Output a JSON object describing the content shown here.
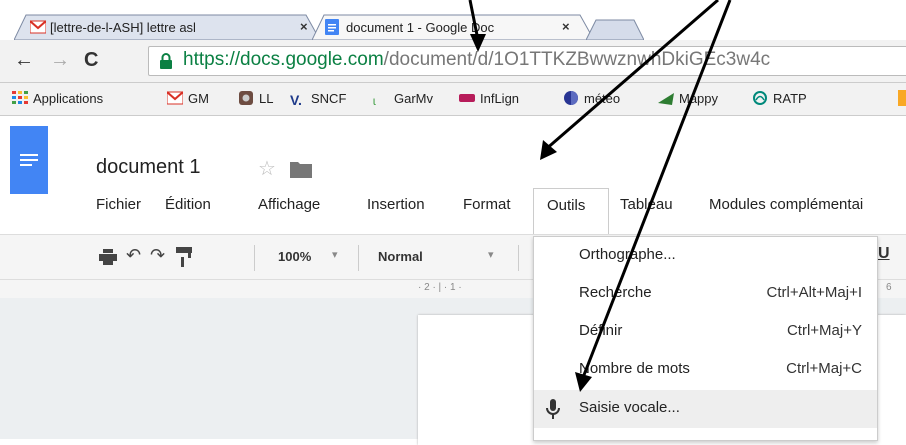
{
  "tabs": [
    {
      "title": "[lettre-de-l-ASH] lettre asl",
      "close": "×"
    },
    {
      "title": "document 1 - Google Doc",
      "close": "×"
    }
  ],
  "address": {
    "url_host": "https://docs.google.com",
    "url_path": "/document/d/1O1TTKZBwwznwhDkiGEc3w4c"
  },
  "bookmarks": [
    {
      "label": "Applications",
      "icon": "apps-grid-icon"
    },
    {
      "label": "GM",
      "icon": "gmail-icon"
    },
    {
      "label": "LL",
      "icon": "instagram-icon"
    },
    {
      "label": "SNCF",
      "icon": "sncf-icon"
    },
    {
      "label": "GarMv",
      "icon": "garmv-icon"
    },
    {
      "label": "InfLign",
      "icon": "sncf-logo-icon"
    },
    {
      "label": "météo",
      "icon": "meteo-icon"
    },
    {
      "label": "Mappy",
      "icon": "mappy-icon"
    },
    {
      "label": "RATP",
      "icon": "ratp-icon"
    }
  ],
  "doc": {
    "title": "document 1",
    "star": "☆",
    "menus": [
      "Fichier",
      "Édition",
      "Affichage",
      "Insertion",
      "Format",
      "Outils",
      "Tableau",
      "Modules complémentai"
    ]
  },
  "format_toolbar": {
    "zoom": "100%",
    "style": "Normal",
    "underline": "U"
  },
  "ruler": {
    "ticks_left": "· 2 · | · 1 ·",
    "tick_right": "6"
  },
  "dropdown": {
    "items": [
      {
        "label": "Orthographe...",
        "shortcut": ""
      },
      {
        "label": "Recherche",
        "shortcut": "Ctrl+Alt+Maj+I"
      },
      {
        "label": "Définir",
        "shortcut": "Ctrl+Maj+Y"
      },
      {
        "label": "Nombre de mots",
        "shortcut": "Ctrl+Maj+C"
      },
      {
        "label": "Saisie vocale...",
        "shortcut": ""
      }
    ]
  },
  "colors": {
    "docs_blue": "#4285f4",
    "url_green": "#0b8043",
    "highlight": "#eeeeee",
    "arrow": "#000000"
  }
}
